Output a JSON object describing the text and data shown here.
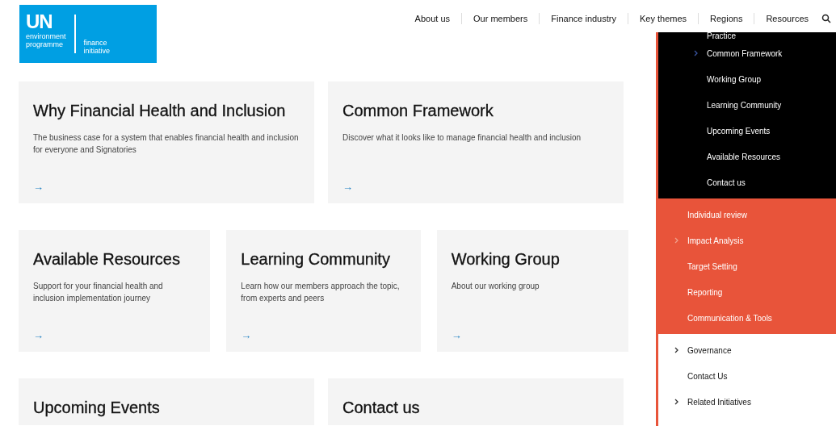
{
  "logo": {
    "mark": "UN",
    "org": [
      "environment",
      "programme"
    ],
    "initiative": [
      "finance",
      "initiative"
    ]
  },
  "nav": {
    "items": [
      "About us",
      "Our members",
      "Finance industry",
      "Key themes",
      "Regions",
      "Resources"
    ]
  },
  "cards": [
    {
      "title": "Why Financial Health and Inclusion",
      "text": "The business case for a system that enables financial health and inclusion for everyone and Signatories",
      "arrow": "→"
    },
    {
      "title": "Common Framework",
      "text": "Discover what it looks like to manage financial health and inclusion",
      "arrow": "→"
    },
    {
      "title": "Available Resources",
      "text": "Support for your financial health and inclusion implementation journey",
      "arrow": "→"
    },
    {
      "title": "Learning Community",
      "text": "Learn how our members approach the topic, from experts and peers",
      "arrow": "→"
    },
    {
      "title": "Working Group",
      "text": "About our working group",
      "arrow": "→"
    },
    {
      "title": "Upcoming Events"
    },
    {
      "title": "Contact us"
    }
  ],
  "menu": {
    "sections": [
      {
        "kind": "dark",
        "items": [
          {
            "label": "Practice",
            "has_children": false
          },
          {
            "label": "Common Framework",
            "has_children": true
          },
          {
            "label": "Working Group",
            "has_children": false
          },
          {
            "label": "Learning Community",
            "has_children": false
          },
          {
            "label": "Upcoming Events",
            "has_children": false
          },
          {
            "label": "Available Resources",
            "has_children": false
          },
          {
            "label": "Contact us",
            "has_children": false
          }
        ]
      },
      {
        "kind": "accent",
        "items": [
          {
            "label": "Individual review",
            "has_children": false
          },
          {
            "label": "Impact Analysis",
            "has_children": true
          },
          {
            "label": "Target Setting",
            "has_children": false
          },
          {
            "label": "Reporting",
            "has_children": false
          },
          {
            "label": "Communication & Tools",
            "has_children": false
          }
        ]
      },
      {
        "kind": "light",
        "items": [
          {
            "label": "Governance",
            "has_children": true
          },
          {
            "label": "Contact Us",
            "has_children": false
          },
          {
            "label": "Related Initiatives",
            "has_children": true
          }
        ]
      }
    ]
  }
}
